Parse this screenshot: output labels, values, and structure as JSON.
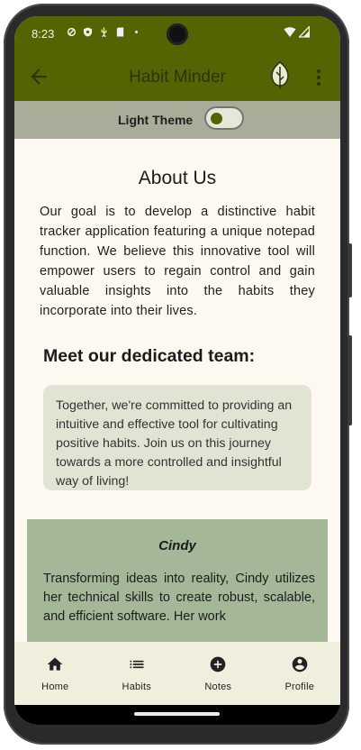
{
  "status_bar": {
    "time": "8:23",
    "icons": [
      "vpn-key-icon",
      "shield-icon",
      "usb-icon",
      "sd-card-icon",
      "dot-icon"
    ],
    "right_icons": [
      "wifi-icon",
      "signal-icon"
    ]
  },
  "app_bar": {
    "title": "Habit Minder",
    "back_icon": "arrow-back-icon",
    "logo_icon": "leaf-icon",
    "menu_icon": "more-vert-icon",
    "color": "#556403"
  },
  "theme_toggle": {
    "label": "Light Theme",
    "enabled": true
  },
  "about": {
    "heading": "About Us",
    "paragraph": "Our goal is to develop a distinctive habit tracker application featuring a unique notepad function. We believe this innovative tool will empower users to regain control and gain valuable insights into the habits they incorporate into their lives."
  },
  "team": {
    "heading": "Meet our dedicated team:",
    "card_text": "Together, we're committed to providing an intuitive and effective tool for cultivating positive habits. Join us on this journey towards a more controlled and insightful way of living!",
    "members": [
      {
        "name": "Cindy",
        "bio": "Transforming ideas into reality, Cindy utilizes her technical skills to create robust, scalable, and efficient software. Her work"
      }
    ]
  },
  "bottom_nav": {
    "items": [
      {
        "label": "Home",
        "icon": "home-icon"
      },
      {
        "label": "Habits",
        "icon": "list-icon"
      },
      {
        "label": "Notes",
        "icon": "add-circle-icon"
      },
      {
        "label": "Profile",
        "icon": "account-circle-icon"
      }
    ]
  },
  "colors": {
    "primary": "#556403",
    "theme_strip": "#a9ac99",
    "card": "#e1e3d3",
    "member_card": "#a4b899",
    "background": "#fdf9f0"
  }
}
